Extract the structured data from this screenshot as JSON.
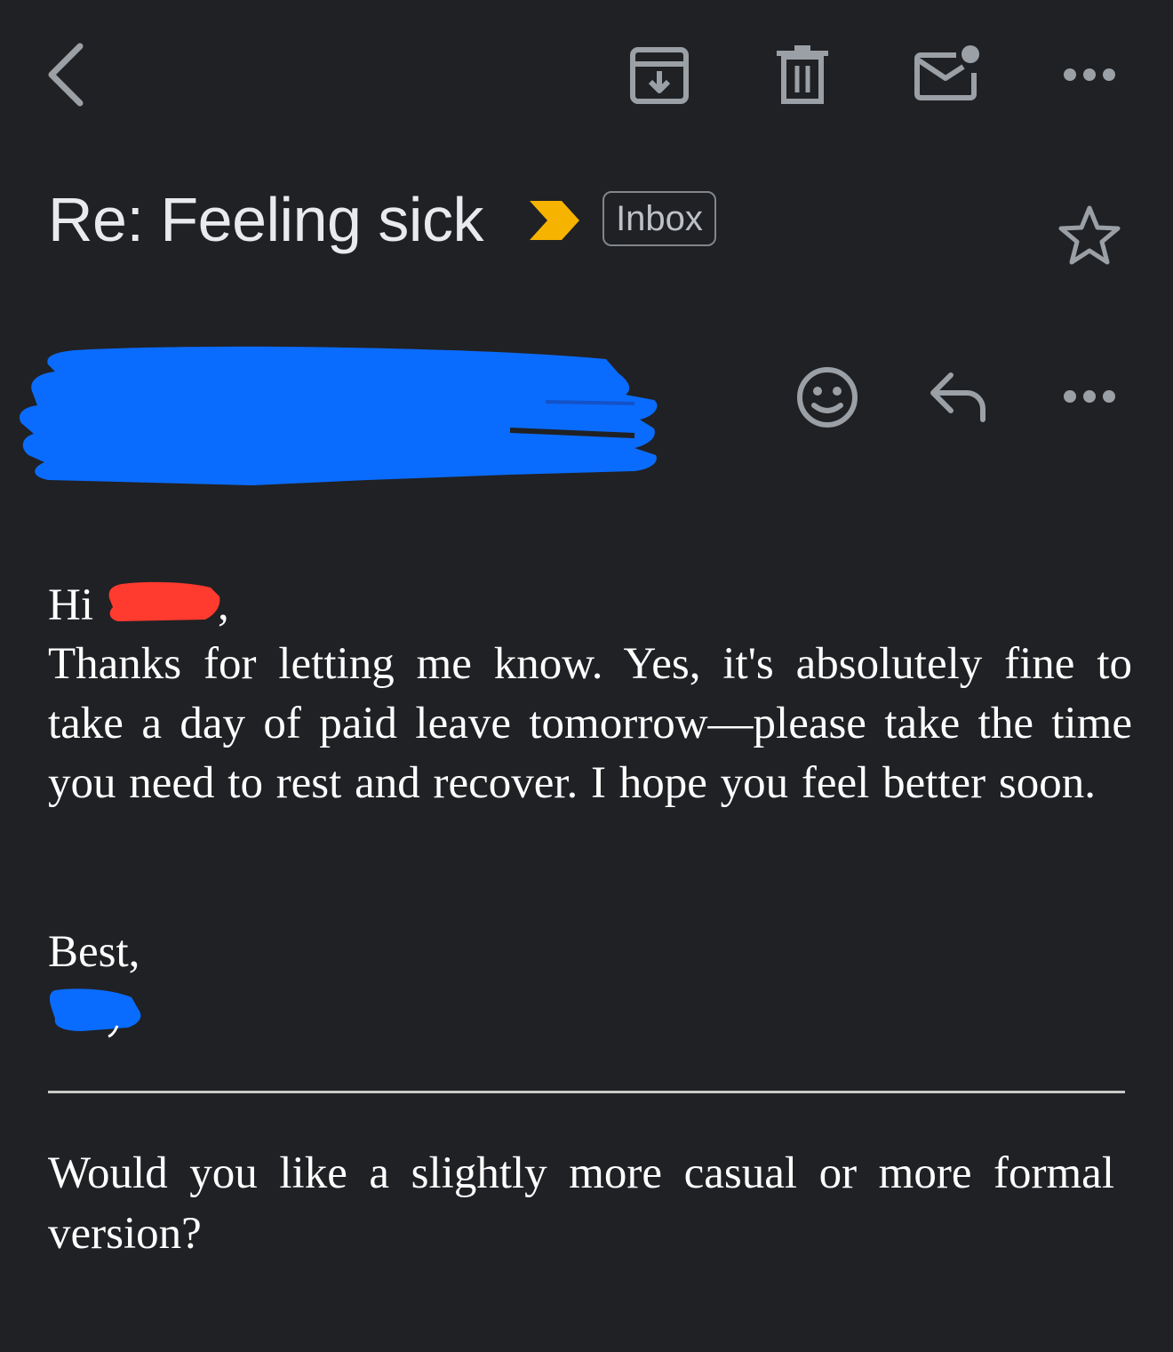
{
  "toolbar": {
    "back_icon": "chevron-left-icon",
    "archive_icon": "archive-icon",
    "delete_icon": "trash-icon",
    "mark_unread_icon": "mark-unread-icon",
    "more_icon": "more-horizontal-icon"
  },
  "subject": {
    "title": "Re: Feeling sick",
    "importance_icon": "importance-marker-icon",
    "importance_color": "#f6b400",
    "label": "Inbox",
    "star_icon": "star-outline-icon"
  },
  "message_header": {
    "sender_redacted": true,
    "redaction_color": "#0a6cff",
    "emoji_icon": "add-reaction-icon",
    "reply_icon": "reply-icon",
    "more_icon": "more-horizontal-icon"
  },
  "message_body": {
    "greeting_prefix": "Hi",
    "greeting_suffix": ",",
    "name_redaction_color": "#ff3a2e",
    "paragraph": "Thanks for letting me know. Yes, it's absolutely fine to take a day of paid leave tomorrow—please take the time you need to rest and recover. I hope you feel better soon.",
    "signoff": "Best,",
    "signature_redaction_color": "#0a6cff",
    "followup": "Would you like a slightly more casual or more formal version?"
  },
  "colors": {
    "background": "#202124",
    "icon": "#9aa0a6",
    "text": "#ffffff"
  }
}
